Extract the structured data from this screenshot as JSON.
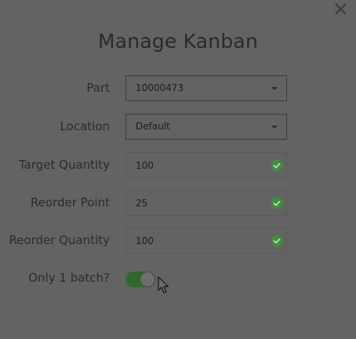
{
  "dialog": {
    "title": "Manage Kanban",
    "close_icon": "close-icon"
  },
  "form": {
    "part": {
      "label": "Part",
      "value": "10000473"
    },
    "location": {
      "label": "Location",
      "value": "Default"
    },
    "target_quantity": {
      "label": "Target Quantity",
      "value": "100",
      "valid": true
    },
    "reorder_point": {
      "label": "Reorder Point",
      "value": "25",
      "valid": true
    },
    "reorder_quantity": {
      "label": "Reorder Quantity",
      "value": "100",
      "valid": true
    },
    "only_one_batch": {
      "label": "Only 1 batch?",
      "enabled": true
    }
  },
  "colors": {
    "valid_check": "#3f8f3c",
    "toggle_on": "#2f6a2c"
  },
  "icons": {
    "dropdown": "chevron-down-icon",
    "valid": "check-circle-icon",
    "pointer": "mouse-pointer-icon"
  }
}
